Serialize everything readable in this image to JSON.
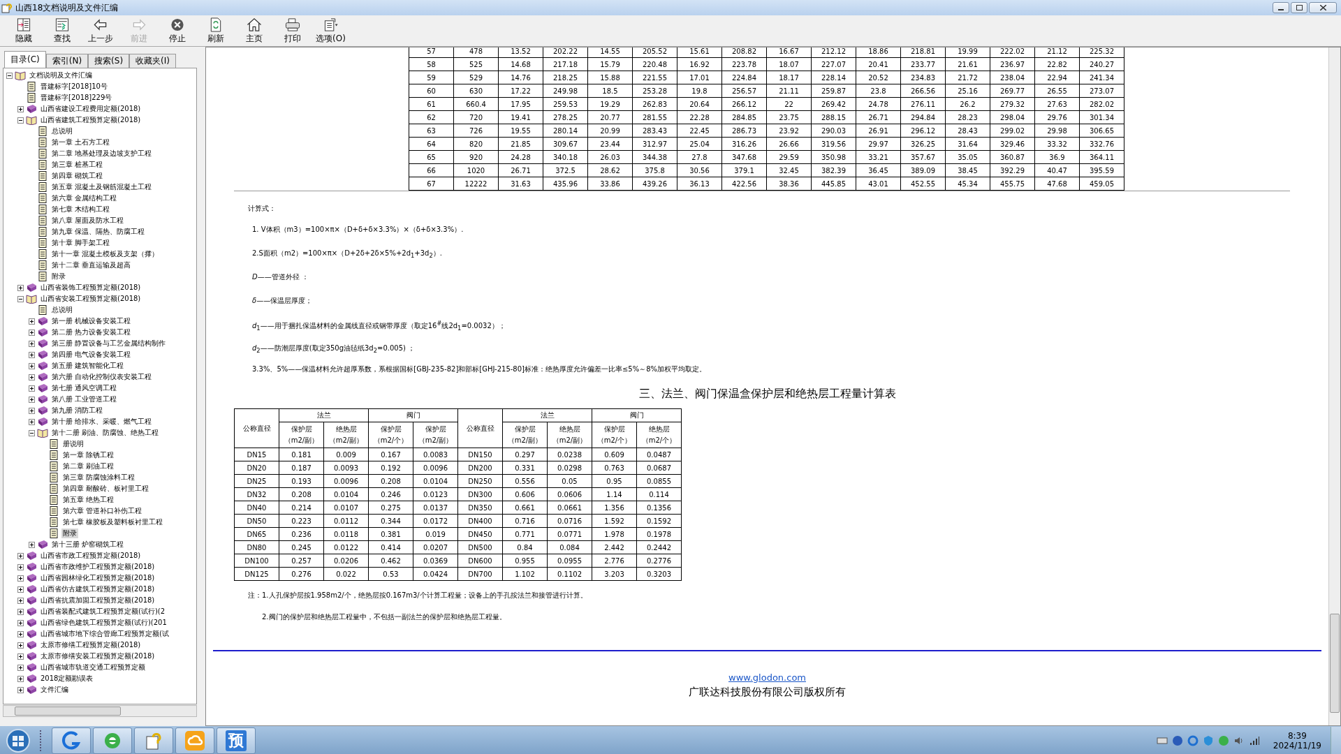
{
  "window": {
    "title": "山西18文档说明及文件汇编"
  },
  "toolbar": {
    "buttons": [
      {
        "label": "隐藏",
        "disabled": false
      },
      {
        "label": "查找",
        "disabled": false
      },
      {
        "label": "上一步",
        "disabled": false
      },
      {
        "label": "前进",
        "disabled": true
      },
      {
        "label": "停止",
        "disabled": false
      },
      {
        "label": "刷新",
        "disabled": false
      },
      {
        "label": "主页",
        "disabled": false
      },
      {
        "label": "打印",
        "disabled": false
      },
      {
        "label": "选项(O)",
        "disabled": false
      }
    ]
  },
  "tabs": [
    {
      "label": "目录(C)",
      "selected": true
    },
    {
      "label": "索引(N)",
      "selected": false
    },
    {
      "label": "搜索(S)",
      "selected": false
    },
    {
      "label": "收藏夹(I)",
      "selected": false
    }
  ],
  "tree": [
    {
      "label": "文档说明及文件汇编",
      "kind": "book",
      "expanded": true,
      "selected": false,
      "children": [
        {
          "label": "晋建标字[2018]10号",
          "kind": "page",
          "selected": false
        },
        {
          "label": "晋建标字[2018]229号",
          "kind": "page",
          "selected": false
        },
        {
          "label": "山西省建设工程费用定额(2018)",
          "kind": "book",
          "expanded": false,
          "selected": false
        },
        {
          "label": "山西省建筑工程预算定额(2018)",
          "kind": "book",
          "expanded": true,
          "selected": false,
          "children": [
            {
              "label": "总说明",
              "kind": "page",
              "selected": false
            },
            {
              "label": "第一章 土石方工程",
              "kind": "page",
              "selected": false
            },
            {
              "label": "第二章 地基处理及边坡支护工程",
              "kind": "page",
              "selected": false
            },
            {
              "label": "第三章 桩基工程",
              "kind": "page",
              "selected": false
            },
            {
              "label": "第四章 砌筑工程",
              "kind": "page",
              "selected": false
            },
            {
              "label": "第五章 混凝土及钢筋混凝土工程",
              "kind": "page",
              "selected": false
            },
            {
              "label": "第六章 金属结构工程",
              "kind": "page",
              "selected": false
            },
            {
              "label": "第七章 木结构工程",
              "kind": "page",
              "selected": false
            },
            {
              "label": "第八章 屋面及防水工程",
              "kind": "page",
              "selected": false
            },
            {
              "label": "第九章 保温、隔热、防腐工程",
              "kind": "page",
              "selected": false
            },
            {
              "label": "第十章 脚手架工程",
              "kind": "page",
              "selected": false
            },
            {
              "label": "第十一章 混凝土模板及支架（撑）",
              "kind": "page",
              "selected": false
            },
            {
              "label": "第十二章 垂直运输及超高",
              "kind": "page",
              "selected": false
            },
            {
              "label": "附录",
              "kind": "page",
              "selected": false
            }
          ]
        },
        {
          "label": "山西省装饰工程预算定额(2018)",
          "kind": "book",
          "expanded": false,
          "selected": false
        },
        {
          "label": "山西省安装工程预算定额(2018)",
          "kind": "book",
          "expanded": true,
          "selected": false,
          "children": [
            {
              "label": "总说明",
              "kind": "page",
              "selected": false
            },
            {
              "label": "第一册 机械设备安装工程",
              "kind": "book",
              "expanded": false,
              "selected": false
            },
            {
              "label": "第二册 热力设备安装工程",
              "kind": "book",
              "expanded": false,
              "selected": false
            },
            {
              "label": "第三册 静置设备与工艺金属结构制作",
              "kind": "book",
              "expanded": false,
              "selected": false
            },
            {
              "label": "第四册 电气设备安装工程",
              "kind": "book",
              "expanded": false,
              "selected": false
            },
            {
              "label": "第五册 建筑智能化工程",
              "kind": "book",
              "expanded": false,
              "selected": false
            },
            {
              "label": "第六册 自动化控制仪表安装工程",
              "kind": "book",
              "expanded": false,
              "selected": false
            },
            {
              "label": "第七册 通风空调工程",
              "kind": "book",
              "expanded": false,
              "selected": false
            },
            {
              "label": "第八册 工业管道工程",
              "kind": "book",
              "expanded": false,
              "selected": false
            },
            {
              "label": "第九册 消防工程",
              "kind": "book",
              "expanded": false,
              "selected": false
            },
            {
              "label": "第十册 给排水、采暖、燃气工程",
              "kind": "book",
              "expanded": false,
              "selected": false
            },
            {
              "label": "第十二册 刷油、防腐蚀、绝热工程",
              "kind": "book",
              "expanded": true,
              "selected": false,
              "children": [
                {
                  "label": "册说明",
                  "kind": "page",
                  "selected": false
                },
                {
                  "label": "第一章 除锈工程",
                  "kind": "page",
                  "selected": false
                },
                {
                  "label": "第二章 刷油工程",
                  "kind": "page",
                  "selected": false
                },
                {
                  "label": "第三章 防腐蚀涂料工程",
                  "kind": "page",
                  "selected": false
                },
                {
                  "label": "第四章 耐酸砖、板衬里工程",
                  "kind": "page",
                  "selected": false
                },
                {
                  "label": "第五章 绝热工程",
                  "kind": "page",
                  "selected": false
                },
                {
                  "label": "第六章 管道补口补伤工程",
                  "kind": "page",
                  "selected": false
                },
                {
                  "label": "第七章 橡胶板及塑料板衬里工程",
                  "kind": "page",
                  "selected": false
                },
                {
                  "label": "附录",
                  "kind": "page",
                  "selected": true
                }
              ]
            },
            {
              "label": "第十三册 炉窑砌筑工程",
              "kind": "book",
              "expanded": false,
              "selected": false
            }
          ]
        },
        {
          "label": "山西省市政工程预算定额(2018)",
          "kind": "book",
          "expanded": false,
          "selected": false
        },
        {
          "label": "山西省市政维护工程预算定额(2018)",
          "kind": "book",
          "expanded": false,
          "selected": false
        },
        {
          "label": "山西省园林绿化工程预算定额(2018)",
          "kind": "book",
          "expanded": false,
          "selected": false
        },
        {
          "label": "山西省仿古建筑工程预算定额(2018)",
          "kind": "book",
          "expanded": false,
          "selected": false
        },
        {
          "label": "山西省抗震加固工程预算定额(2018)",
          "kind": "book",
          "expanded": false,
          "selected": false
        },
        {
          "label": "山西省装配式建筑工程预算定额(试行)(2",
          "kind": "book",
          "expanded": false,
          "selected": false
        },
        {
          "label": "山西省绿色建筑工程预算定额(试行)(201",
          "kind": "book",
          "expanded": false,
          "selected": false
        },
        {
          "label": "山西省城市地下综合管廊工程预算定额(试",
          "kind": "book",
          "expanded": false,
          "selected": false
        },
        {
          "label": "太原市修缮工程预算定额(2018)",
          "kind": "book",
          "expanded": false,
          "selected": false
        },
        {
          "label": "太原市修缮安装工程预算定额(2018)",
          "kind": "book",
          "expanded": false,
          "selected": false
        },
        {
          "label": "山西省城市轨道交通工程预算定额",
          "kind": "book",
          "expanded": false,
          "selected": false
        },
        {
          "label": "2018定额勘误表",
          "kind": "book",
          "expanded": false,
          "selected": false
        },
        {
          "label": "文件汇编",
          "kind": "book",
          "expanded": false,
          "selected": false
        }
      ]
    }
  ],
  "top_table": {
    "rows": [
      [
        "57",
        "478",
        "13.52",
        "202.22",
        "14.55",
        "205.52",
        "15.61",
        "208.82",
        "16.67",
        "212.12",
        "18.86",
        "218.81",
        "19.99",
        "222.02",
        "21.12",
        "225.32"
      ],
      [
        "58",
        "525",
        "14.68",
        "217.18",
        "15.79",
        "220.48",
        "16.92",
        "223.78",
        "18.07",
        "227.07",
        "20.41",
        "233.77",
        "21.61",
        "236.97",
        "22.82",
        "240.27"
      ],
      [
        "59",
        "529",
        "14.76",
        "218.25",
        "15.88",
        "221.55",
        "17.01",
        "224.84",
        "18.17",
        "228.14",
        "20.52",
        "234.83",
        "21.72",
        "238.04",
        "22.94",
        "241.34"
      ],
      [
        "60",
        "630",
        "17.22",
        "249.98",
        "18.5",
        "253.28",
        "19.8",
        "256.57",
        "21.11",
        "259.87",
        "23.8",
        "266.56",
        "25.16",
        "269.77",
        "26.55",
        "273.07"
      ],
      [
        "61",
        "660.4",
        "17.95",
        "259.53",
        "19.29",
        "262.83",
        "20.64",
        "266.12",
        "22",
        "269.42",
        "24.78",
        "276.11",
        "26.2",
        "279.32",
        "27.63",
        "282.02"
      ],
      [
        "62",
        "720",
        "19.41",
        "278.25",
        "20.77",
        "281.55",
        "22.28",
        "284.85",
        "23.75",
        "288.15",
        "26.71",
        "294.84",
        "28.23",
        "298.04",
        "29.76",
        "301.34"
      ],
      [
        "63",
        "726",
        "19.55",
        "280.14",
        "20.99",
        "283.43",
        "22.45",
        "286.73",
        "23.92",
        "290.03",
        "26.91",
        "296.12",
        "28.43",
        "299.02",
        "29.98",
        "306.65"
      ],
      [
        "64",
        "820",
        "21.85",
        "309.67",
        "23.44",
        "312.97",
        "25.04",
        "316.26",
        "26.66",
        "319.56",
        "29.97",
        "326.25",
        "31.64",
        "329.46",
        "33.32",
        "332.76"
      ],
      [
        "65",
        "920",
        "24.28",
        "340.18",
        "26.03",
        "344.38",
        "27.8",
        "347.68",
        "29.59",
        "350.98",
        "33.21",
        "357.67",
        "35.05",
        "360.87",
        "36.9",
        "364.11"
      ],
      [
        "66",
        "1020",
        "26.71",
        "372.5",
        "28.62",
        "375.8",
        "30.56",
        "379.1",
        "32.45",
        "382.39",
        "36.45",
        "389.09",
        "38.45",
        "392.29",
        "40.47",
        "395.59"
      ],
      [
        "67",
        "12222",
        "31.63",
        "435.96",
        "33.86",
        "439.26",
        "36.13",
        "422.56",
        "38.36",
        "445.85",
        "43.01",
        "452.55",
        "45.34",
        "455.75",
        "47.68",
        "459.05"
      ]
    ]
  },
  "formulas": {
    "title": "计算式：",
    "lines": [
      "1. V体积（m3）=100×π×（D+δ+δ×3.3%）×（δ+δ×3.3%）.",
      "2.S面积（m2）=100×π×（D+2δ+2δ×5%+2d$_{1}$+3d$_{2}$）.",
      "*D*——管道外径 ：",
      "*δ*——保温层厚度；",
      "*d*$_{1}$——用于捆扎保温材料的金属线直径或钢带厚度（取定16$^{#}$线2d$_{1}$=0.0032）；",
      "*d*$_{2}$——防潮层厚度(取定350g油毡纸3d$_{2}$=0.005) ；",
      "3.3%、5%——保温材料允许超厚系数，系根据国标[GBJ-235-82]和部标[GHJ-215-80]标准：绝热厚度允许偏差一比率≤5%～8%加权平均取定。"
    ]
  },
  "section_title": "三、法兰、阀门保温盒保护层和绝热层工程量计算表",
  "bottom_table": {
    "left_header": "公称直径",
    "right_header": "公称直径",
    "groups": [
      {
        "label": "法兰",
        "columns": [
          {
            "label": "保护层",
            "unit": "（m2/副）"
          },
          {
            "label": "绝热层",
            "unit": "（m2/副）"
          }
        ]
      },
      {
        "label": "阀门",
        "columns": [
          {
            "label": "保护层",
            "unit": "（m2/个）"
          },
          {
            "label": "保护层",
            "unit": "（m2/副）"
          }
        ]
      }
    ],
    "groups_right": [
      {
        "label": "法兰",
        "columns": [
          {
            "label": "保护层",
            "unit": "（m2/副）"
          },
          {
            "label": "绝热层",
            "unit": "（m2/副）"
          }
        ]
      },
      {
        "label": "阀门",
        "columns": [
          {
            "label": "保护层",
            "unit": "（m2/个）"
          },
          {
            "label": "绝热层",
            "unit": "（m2/个）"
          }
        ]
      }
    ],
    "rows": [
      [
        "DN15",
        "0.181",
        "0.009",
        "0.167",
        "0.0083",
        "DN150",
        "0.297",
        "0.0238",
        "0.609",
        "0.0487"
      ],
      [
        "DN20",
        "0.187",
        "0.0093",
        "0.192",
        "0.0096",
        "DN200",
        "0.331",
        "0.0298",
        "0.763",
        "0.0687"
      ],
      [
        "DN25",
        "0.193",
        "0.0096",
        "0.208",
        "0.0104",
        "DN250",
        "0.556",
        "0.05",
        "0.95",
        "0.0855"
      ],
      [
        "DN32",
        "0.208",
        "0.0104",
        "0.246",
        "0.0123",
        "DN300",
        "0.606",
        "0.0606",
        "1.14",
        "0.114"
      ],
      [
        "DN40",
        "0.214",
        "0.0107",
        "0.275",
        "0.0137",
        "DN350",
        "0.661",
        "0.0661",
        "1.356",
        "0.1356"
      ],
      [
        "DN50",
        "0.223",
        "0.0112",
        "0.344",
        "0.0172",
        "DN400",
        "0.716",
        "0.0716",
        "1.592",
        "0.1592"
      ],
      [
        "DN65",
        "0.236",
        "0.0118",
        "0.381",
        "0.019",
        "DN450",
        "0.771",
        "0.0771",
        "1.978",
        "0.1978"
      ],
      [
        "DN80",
        "0.245",
        "0.0122",
        "0.414",
        "0.0207",
        "DN500",
        "0.84",
        "0.084",
        "2.442",
        "0.2442"
      ],
      [
        "DN100",
        "0.257",
        "0.0206",
        "0.462",
        "0.0369",
        "DN600",
        "0.955",
        "0.0955",
        "2.776",
        "0.2776"
      ],
      [
        "DN125",
        "0.276",
        "0.022",
        "0.53",
        "0.0424",
        "DN700",
        "1.102",
        "0.1102",
        "3.203",
        "0.3203"
      ]
    ]
  },
  "notes": [
    "注：1.人孔保护层按1.958m2/个，绝热层按0.167m3/个计算工程量；设备上的手孔按法兰和接管进行计算。",
    "2.阀门的保护层和绝热层工程量中，不包括一副法兰的保护层和绝热层工程量。"
  ],
  "footer": {
    "link": "www.glodon.com",
    "copyright": "广联达科技股份有限公司版权所有"
  },
  "taskbar": {
    "app_label": "预",
    "clock": {
      "time": "8:39",
      "date": "2024/11/19"
    }
  }
}
